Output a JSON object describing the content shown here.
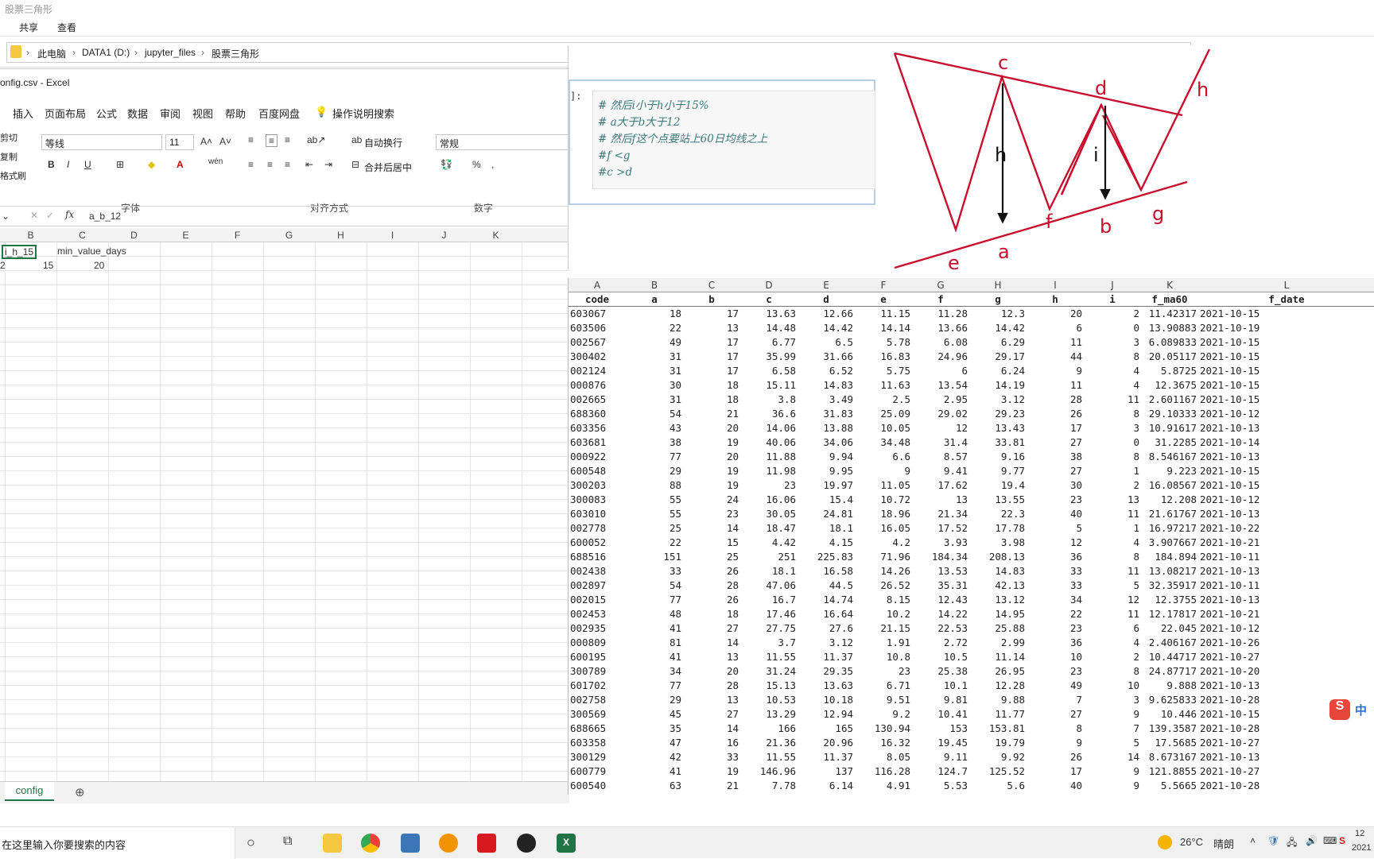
{
  "explorer": {
    "title": "股票三角形",
    "ribbon_tabs": [
      "共享",
      "查看"
    ],
    "breadcrumb": [
      "此电脑",
      "DATA1 (D:)",
      "jupyter_files",
      "股票三角形"
    ]
  },
  "excel": {
    "title": "onfig.csv  -  Excel",
    "tabs": [
      "插入",
      "页面布局",
      "公式",
      "数据",
      "审阅",
      "视图",
      "帮助",
      "百度网盘",
      "操作说明搜索"
    ],
    "clipboard": [
      "剪切",
      "复制",
      "格式刷"
    ],
    "font_name": "等线",
    "font_size": "11",
    "wrap_text": "自动换行",
    "merge_center": "合并后居中",
    "number_format": "常规",
    "groups": [
      "字体",
      "对齐方式",
      "数字"
    ],
    "formula_value": "a_b_12",
    "columns": [
      "B",
      "C",
      "D",
      "E",
      "F",
      "G",
      "H",
      "I",
      "J",
      "K"
    ],
    "cells": {
      "a1": "i_h_15",
      "b1": "min_value_days",
      "a2": "2",
      "b2": "15",
      "c2": "20"
    },
    "sheet_tab": "config",
    "add_sheet": "⊕"
  },
  "jupyter": {
    "prompt": "]:",
    "code_lines": [
      "# 然后i小于h小于15%",
      "# a大于b大于12",
      "# 然后f这个点要站上60日均线之上",
      "#f <g",
      "#c >d"
    ]
  },
  "diagram_labels": [
    "c",
    "d",
    "h",
    "h",
    "i",
    "e",
    "a",
    "f",
    "b",
    "g"
  ],
  "csv": {
    "col_letters": [
      "A",
      "B",
      "C",
      "D",
      "E",
      "F",
      "G",
      "H",
      "I",
      "J",
      "K",
      "L"
    ],
    "headers": [
      "code",
      "a",
      "b",
      "c",
      "d",
      "e",
      "f",
      "g",
      "h",
      "i",
      "f_ma60",
      "f_date"
    ],
    "rows": [
      [
        "603067",
        "18",
        "17",
        "13.63",
        "12.66",
        "11.15",
        "11.28",
        "12.3",
        "20",
        "2",
        "11.42317",
        "2021-10-15"
      ],
      [
        "603506",
        "22",
        "13",
        "14.48",
        "14.42",
        "14.14",
        "13.66",
        "14.42",
        "6",
        "0",
        "13.90883",
        "2021-10-19"
      ],
      [
        "002567",
        "49",
        "17",
        "6.77",
        "6.5",
        "5.78",
        "6.08",
        "6.29",
        "11",
        "3",
        "6.089833",
        "2021-10-15"
      ],
      [
        "300402",
        "31",
        "17",
        "35.99",
        "31.66",
        "16.83",
        "24.96",
        "29.17",
        "44",
        "8",
        "20.05117",
        "2021-10-15"
      ],
      [
        "002124",
        "31",
        "17",
        "6.58",
        "6.52",
        "5.75",
        "6",
        "6.24",
        "9",
        "4",
        "5.8725",
        "2021-10-15"
      ],
      [
        "000876",
        "30",
        "18",
        "15.11",
        "14.83",
        "11.63",
        "13.54",
        "14.19",
        "11",
        "4",
        "12.3675",
        "2021-10-15"
      ],
      [
        "002665",
        "31",
        "18",
        "3.8",
        "3.49",
        "2.5",
        "2.95",
        "3.12",
        "28",
        "11",
        "2.601167",
        "2021-10-15"
      ],
      [
        "688360",
        "54",
        "21",
        "36.6",
        "31.83",
        "25.09",
        "29.02",
        "29.23",
        "26",
        "8",
        "29.10333",
        "2021-10-12"
      ],
      [
        "603356",
        "43",
        "20",
        "14.06",
        "13.88",
        "10.05",
        "12",
        "13.43",
        "17",
        "3",
        "10.91617",
        "2021-10-13"
      ],
      [
        "603681",
        "38",
        "19",
        "40.06",
        "34.06",
        "34.48",
        "31.4",
        "33.81",
        "27",
        "0",
        "31.2285",
        "2021-10-14"
      ],
      [
        "000922",
        "77",
        "20",
        "11.88",
        "9.94",
        "6.6",
        "8.57",
        "9.16",
        "38",
        "8",
        "8.546167",
        "2021-10-13"
      ],
      [
        "600548",
        "29",
        "19",
        "11.98",
        "9.95",
        "9",
        "9.41",
        "9.77",
        "27",
        "1",
        "9.223",
        "2021-10-15"
      ],
      [
        "300203",
        "88",
        "19",
        "23",
        "19.97",
        "11.05",
        "17.62",
        "19.4",
        "30",
        "2",
        "16.08567",
        "2021-10-15"
      ],
      [
        "300083",
        "55",
        "24",
        "16.06",
        "15.4",
        "10.72",
        "13",
        "13.55",
        "23",
        "13",
        "12.208",
        "2021-10-12"
      ],
      [
        "603010",
        "55",
        "23",
        "30.05",
        "24.81",
        "18.96",
        "21.34",
        "22.3",
        "40",
        "11",
        "21.61767",
        "2021-10-13"
      ],
      [
        "002778",
        "25",
        "14",
        "18.47",
        "18.1",
        "16.05",
        "17.52",
        "17.78",
        "5",
        "1",
        "16.97217",
        "2021-10-22"
      ],
      [
        "600052",
        "22",
        "15",
        "4.42",
        "4.15",
        "4.2",
        "3.93",
        "3.98",
        "12",
        "4",
        "3.907667",
        "2021-10-21"
      ],
      [
        "688516",
        "151",
        "25",
        "251",
        "225.83",
        "71.96",
        "184.34",
        "208.13",
        "36",
        "8",
        "184.894",
        "2021-10-11"
      ],
      [
        "002438",
        "33",
        "26",
        "18.1",
        "16.58",
        "14.26",
        "13.53",
        "14.83",
        "33",
        "11",
        "13.08217",
        "2021-10-13"
      ],
      [
        "002897",
        "54",
        "28",
        "47.06",
        "44.5",
        "26.52",
        "35.31",
        "42.13",
        "33",
        "5",
        "32.35917",
        "2021-10-11"
      ],
      [
        "002015",
        "77",
        "26",
        "16.7",
        "14.74",
        "8.15",
        "12.43",
        "13.12",
        "34",
        "12",
        "12.3755",
        "2021-10-13"
      ],
      [
        "002453",
        "48",
        "18",
        "17.46",
        "16.64",
        "10.2",
        "14.22",
        "14.95",
        "22",
        "11",
        "12.17817",
        "2021-10-21"
      ],
      [
        "002935",
        "41",
        "27",
        "27.75",
        "27.6",
        "21.15",
        "22.53",
        "25.88",
        "23",
        "6",
        "22.045",
        "2021-10-12"
      ],
      [
        "000809",
        "81",
        "14",
        "3.7",
        "3.12",
        "1.91",
        "2.72",
        "2.99",
        "36",
        "4",
        "2.406167",
        "2021-10-26"
      ],
      [
        "600195",
        "41",
        "13",
        "11.55",
        "11.37",
        "10.8",
        "10.5",
        "11.14",
        "10",
        "2",
        "10.44717",
        "2021-10-27"
      ],
      [
        "300789",
        "34",
        "20",
        "31.24",
        "29.35",
        "23",
        "25.38",
        "26.95",
        "23",
        "8",
        "24.87717",
        "2021-10-20"
      ],
      [
        "601702",
        "77",
        "28",
        "15.13",
        "13.63",
        "6.71",
        "10.1",
        "12.28",
        "49",
        "10",
        "9.888",
        "2021-10-13"
      ],
      [
        "002758",
        "29",
        "13",
        "10.53",
        "10.18",
        "9.51",
        "9.81",
        "9.88",
        "7",
        "3",
        "9.625833",
        "2021-10-28"
      ],
      [
        "300569",
        "45",
        "27",
        "13.29",
        "12.94",
        "9.2",
        "10.41",
        "11.77",
        "27",
        "9",
        "10.446",
        "2021-10-15"
      ],
      [
        "688665",
        "35",
        "14",
        "166",
        "165",
        "130.94",
        "153",
        "153.81",
        "8",
        "7",
        "139.3587",
        "2021-10-28"
      ],
      [
        "603358",
        "47",
        "16",
        "21.36",
        "20.96",
        "16.32",
        "19.45",
        "19.79",
        "9",
        "5",
        "17.5685",
        "2021-10-27"
      ],
      [
        "300129",
        "42",
        "33",
        "11.55",
        "11.37",
        "8.05",
        "9.11",
        "9.92",
        "26",
        "14",
        "8.673167",
        "2021-10-13"
      ],
      [
        "600779",
        "41",
        "19",
        "146.96",
        "137",
        "116.28",
        "124.7",
        "125.52",
        "17",
        "9",
        "121.8855",
        "2021-10-27"
      ],
      [
        "600540",
        "63",
        "21",
        "7.78",
        "6.14",
        "4.91",
        "5.53",
        "5.6",
        "40",
        "9",
        "5.5665",
        "2021-10-28"
      ]
    ]
  },
  "taskbar": {
    "search_placeholder": "在这里输入你要搜索的内容",
    "weather_temp": "26°C",
    "weather_desc": "晴朗",
    "ime": "中",
    "clock_time": "12",
    "clock_date": "2021"
  },
  "colors": {
    "excel_green": "#217346",
    "diagram_red": "#c8102e"
  }
}
